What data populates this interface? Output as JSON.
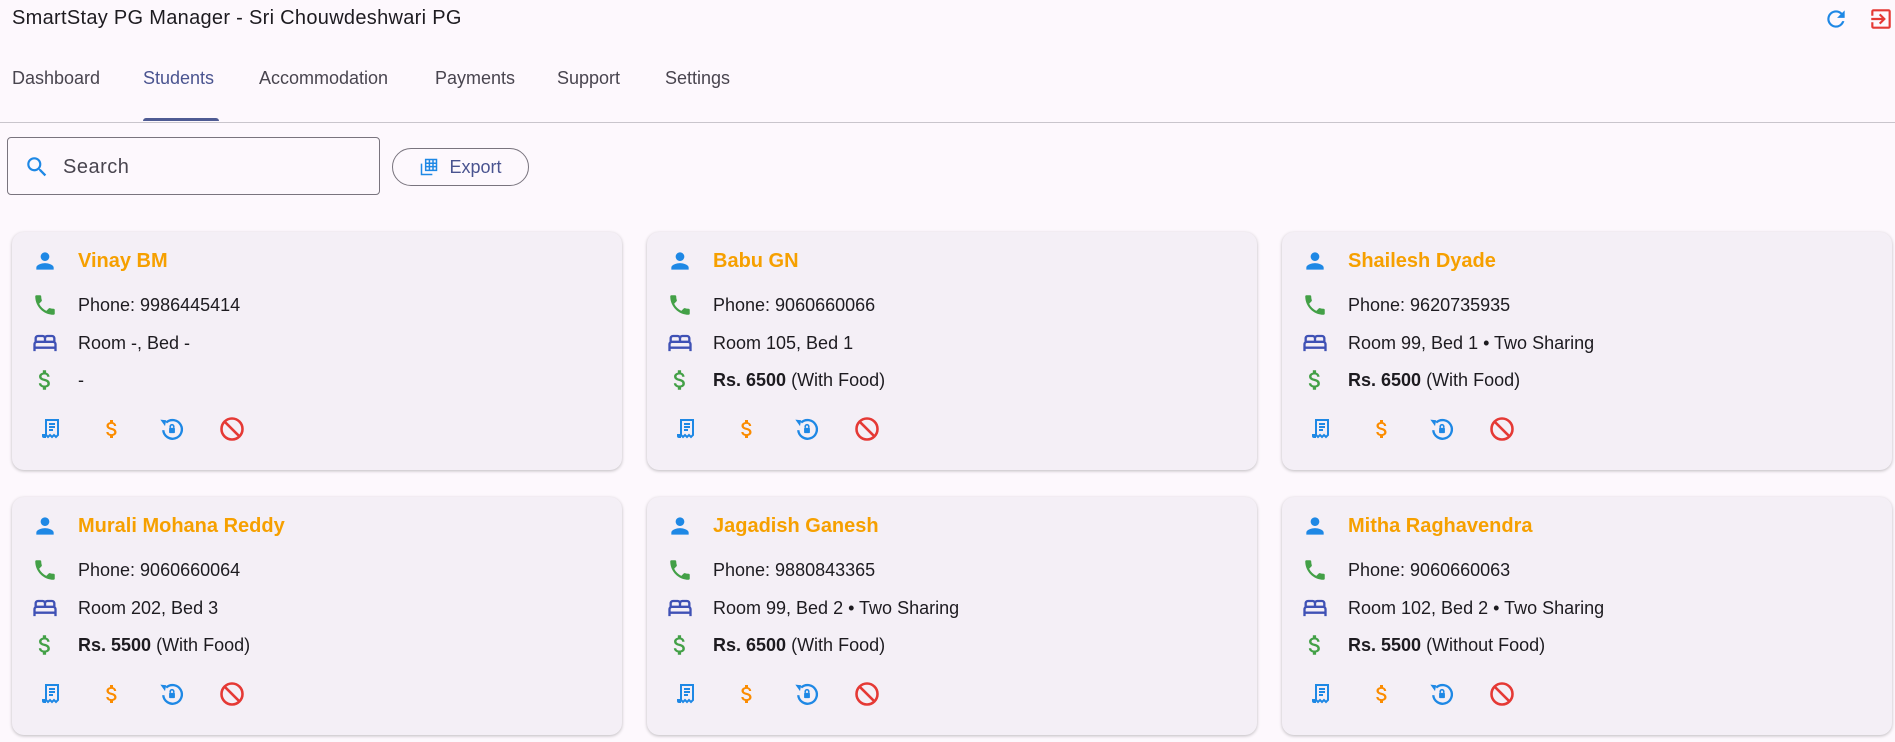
{
  "app": {
    "title": "SmartStay PG Manager - Sri Chouwdeshwari PG"
  },
  "tabs": [
    {
      "label": "Dashboard",
      "active": false
    },
    {
      "label": "Students",
      "active": true
    },
    {
      "label": "Accommodation",
      "active": false
    },
    {
      "label": "Payments",
      "active": false
    },
    {
      "label": "Support",
      "active": false
    },
    {
      "label": "Settings",
      "active": false
    }
  ],
  "search": {
    "placeholder": "Search",
    "value": ""
  },
  "export": {
    "label": "Export"
  },
  "colors": {
    "accent": "#4f5b93",
    "name": "#f6a000",
    "icon_blue": "#1e88e5",
    "icon_green": "#43a047",
    "icon_indigo": "#3f51b5",
    "icon_orange": "#fb8c00",
    "icon_red": "#e53935"
  },
  "students": [
    {
      "name": "Vinay BM",
      "phone": "Phone: 9986445414",
      "room": "Room -, Bed -",
      "rent_amount": "",
      "rent_detail": "-"
    },
    {
      "name": "Babu GN",
      "phone": "Phone: 9060660066",
      "room": "Room 105, Bed 1",
      "rent_amount": "Rs. 6500",
      "rent_detail": "(With Food)"
    },
    {
      "name": "Shailesh Dyade",
      "phone": "Phone: 9620735935",
      "room": "Room 99, Bed 1 • Two Sharing",
      "rent_amount": "Rs. 6500",
      "rent_detail": "(With Food)"
    },
    {
      "name": "Murali Mohana Reddy",
      "phone": "Phone: 9060660064",
      "room": "Room 202, Bed 3",
      "rent_amount": "Rs. 5500",
      "rent_detail": "(With Food)"
    },
    {
      "name": "Jagadish Ganesh",
      "phone": "Phone: 9880843365",
      "room": "Room 99, Bed 2 • Two Sharing",
      "rent_amount": "Rs. 6500",
      "rent_detail": "(With Food)"
    },
    {
      "name": "Mitha Raghavendra",
      "phone": "Phone: 9060660063",
      "room": "Room 102, Bed 2 • Two Sharing",
      "rent_amount": "Rs. 5500",
      "rent_detail": "(Without Food)"
    }
  ],
  "icons": {
    "refresh": "refresh-icon",
    "logout": "logout-icon",
    "search": "search-icon",
    "export": "spreadsheet-icon",
    "person": "person-icon",
    "phone": "phone-icon",
    "bed": "bed-icon",
    "money": "dollar-icon",
    "actions": [
      "receipt-icon",
      "payment-icon",
      "lock-reset-icon",
      "block-icon"
    ]
  }
}
